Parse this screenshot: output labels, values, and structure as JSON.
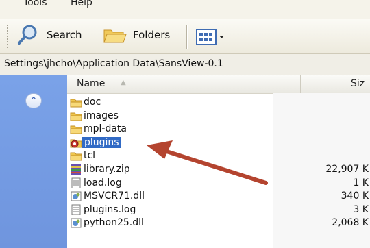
{
  "menu": {
    "tools": "Tools",
    "help": "Help"
  },
  "toolbar": {
    "search_label": "Search",
    "folders_label": "Folders"
  },
  "address": {
    "path": "Settings\\jhcho\\Application Data\\SansView-0.1"
  },
  "columns": {
    "name": "Name",
    "size": "Siz"
  },
  "files": [
    {
      "name": "doc",
      "size": "",
      "icon": "folder-icon",
      "selected": false
    },
    {
      "name": "images",
      "size": "",
      "icon": "folder-icon",
      "selected": false
    },
    {
      "name": "mpl-data",
      "size": "",
      "icon": "folder-icon",
      "selected": false
    },
    {
      "name": "plugins",
      "size": "",
      "icon": "special-folder-icon",
      "selected": true
    },
    {
      "name": "tcl",
      "size": "",
      "icon": "folder-icon",
      "selected": false
    },
    {
      "name": "library.zip",
      "size": "22,907 K",
      "icon": "archive-icon",
      "selected": false
    },
    {
      "name": "load.log",
      "size": "1 K",
      "icon": "text-file-icon",
      "selected": false
    },
    {
      "name": "MSVCR71.dll",
      "size": "340 K",
      "icon": "dll-icon",
      "selected": false
    },
    {
      "name": "plugins.log",
      "size": "3 K",
      "icon": "text-file-icon",
      "selected": false
    },
    {
      "name": "python25.dll",
      "size": "2,068 K",
      "icon": "dll-icon",
      "selected": false
    }
  ],
  "colors": {
    "selection": "#316ac5",
    "arrow": "#b4442f",
    "taskpane": "#7aa2e8"
  }
}
